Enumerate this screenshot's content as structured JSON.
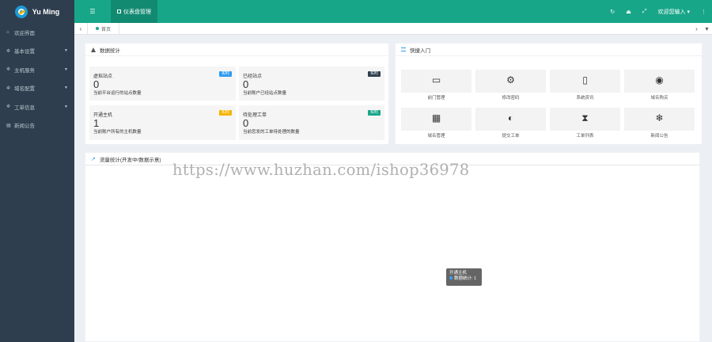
{
  "brand": {
    "title": "Yu Ming"
  },
  "topbar": {
    "menu_icon": "☰",
    "dashboard_tab": "仪表盘管理",
    "refresh_icon": "↻",
    "trash_icon": "⏏",
    "fullscreen_icon": "⤢",
    "user_label": "欢迎您输入 ▾",
    "more_icon": "⋮"
  },
  "sidebar": {
    "items": [
      {
        "icon": "⌂",
        "label": "欢迎界面",
        "caret": ""
      },
      {
        "icon": "✲",
        "label": "基本设置",
        "caret": "▼"
      },
      {
        "icon": "✲",
        "label": "主机服务",
        "caret": "▼"
      },
      {
        "icon": "✲",
        "label": "域名配置",
        "caret": "▼"
      },
      {
        "icon": "✲",
        "label": "工单信息",
        "caret": "▼"
      },
      {
        "icon": "▤",
        "label": "新闻公告",
        "caret": ""
      }
    ]
  },
  "tabrow": {
    "prev": "‹",
    "home_tab": "首页",
    "next": "›",
    "more": "▾"
  },
  "stats_panel": {
    "title": "数据统计",
    "cards": [
      {
        "label": "虚拟站点",
        "badge": "实时",
        "badge_color": "#2f9cef",
        "value": "0",
        "desc": "当前平台运行的站点数量"
      },
      {
        "label": "已经站点",
        "badge": "实时",
        "badge_color": "#2f3e4e",
        "value": "0",
        "desc": "当前账户已经站点数量"
      },
      {
        "label": "开通主机",
        "badge": "实时",
        "badge_color": "#f5b400",
        "value": "1",
        "desc": "当前账户所有的主机数量"
      },
      {
        "label": "待处理工单",
        "badge": "实时",
        "badge_color": "#18a689",
        "value": "0",
        "desc": "当前您发的工单待处理的数量"
      }
    ]
  },
  "quick_panel": {
    "title": "快捷入门",
    "items": [
      {
        "icon": "▭",
        "label": "前门管理"
      },
      {
        "icon": "⚙",
        "label": "修改密码"
      },
      {
        "icon": "▯",
        "label": "系统资讯"
      },
      {
        "icon": "◉",
        "label": "域名购买"
      },
      {
        "icon": "▦",
        "label": "域名管理"
      },
      {
        "icon": "◐",
        "label": "提交工单"
      },
      {
        "icon": "⧗",
        "label": "工单列表"
      },
      {
        "icon": "❄",
        "label": "新闻公告"
      }
    ]
  },
  "chart_panel": {
    "title": "流量统计(开发中/数据示意)"
  },
  "tooltip": {
    "series": "开通主机",
    "line": "数据统计: 1"
  },
  "watermark": "https://www.huzhan.com/ishop36978"
}
